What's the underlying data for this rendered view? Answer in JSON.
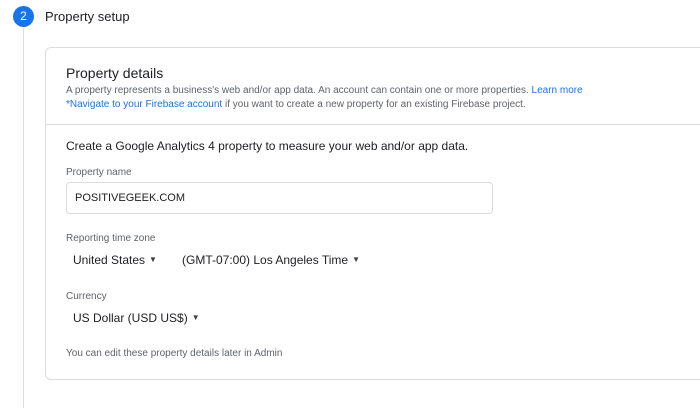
{
  "step": {
    "number": "2",
    "title": "Property setup"
  },
  "card": {
    "title": "Property details",
    "desc_line1": "A property represents a business's web and/or app data. An account can contain one or more properties.",
    "learn_more": "Learn more",
    "firebase_link": "*Navigate to your Firebase account",
    "desc_line2": "if you want to create a new property for an existing Firebase project."
  },
  "form": {
    "intro": "Create a Google Analytics 4 property to measure your web and/or app data.",
    "property_name_label": "Property name",
    "property_name_value": "POSITIVEGEEK.COM",
    "timezone_label": "Reporting time zone",
    "country_value": "United States",
    "timezone_value": "(GMT-07:00) Los Angeles Time",
    "currency_label": "Currency",
    "currency_value": "US Dollar (USD US$)",
    "footnote": "You can edit these property details later in Admin"
  },
  "icons": {
    "caret": "caret-down-icon"
  },
  "colors": {
    "accent": "#1a73e8",
    "border": "#dadce0"
  }
}
